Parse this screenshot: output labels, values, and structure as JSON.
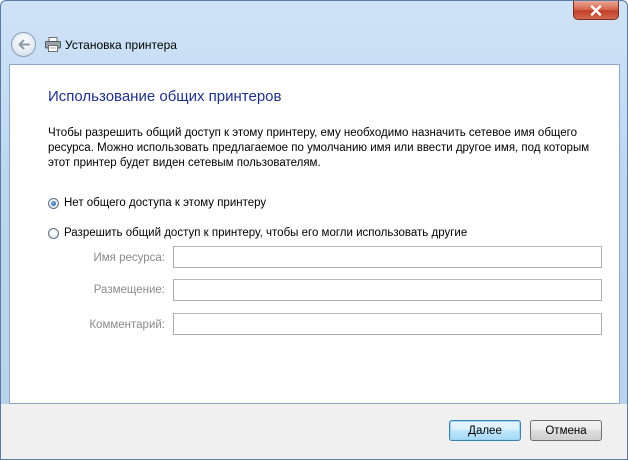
{
  "window": {
    "title": "Установка принтера"
  },
  "titlebar": {
    "close_icon": "close-icon",
    "back_icon": "back-arrow-icon",
    "app_icon": "printer-icon"
  },
  "main": {
    "heading": "Использование общих принтеров",
    "description": "Чтобы разрешить общий доступ к этому принтеру, ему необходимо назначить сетевое имя общего ресурса. Можно использовать предлагаемое по умолчанию имя или ввести другое имя, под которым этот принтер будет виден сетевым пользователям.",
    "options": [
      {
        "label": "Нет общего доступа к этому принтеру",
        "selected": true
      },
      {
        "label": "Разрешить общий доступ к принтеру, чтобы его могли использовать другие",
        "selected": false
      }
    ],
    "fields": [
      {
        "label": "Имя ресурса:",
        "value": ""
      },
      {
        "label": "Размещение:",
        "value": ""
      },
      {
        "label": "Комментарий:",
        "value": ""
      }
    ]
  },
  "footer": {
    "next_label": "Далее",
    "cancel_label": "Отмена"
  },
  "colors": {
    "heading": "#1e3287",
    "disabled_label": "#8a8a8a",
    "close_button": "#c2402a"
  }
}
